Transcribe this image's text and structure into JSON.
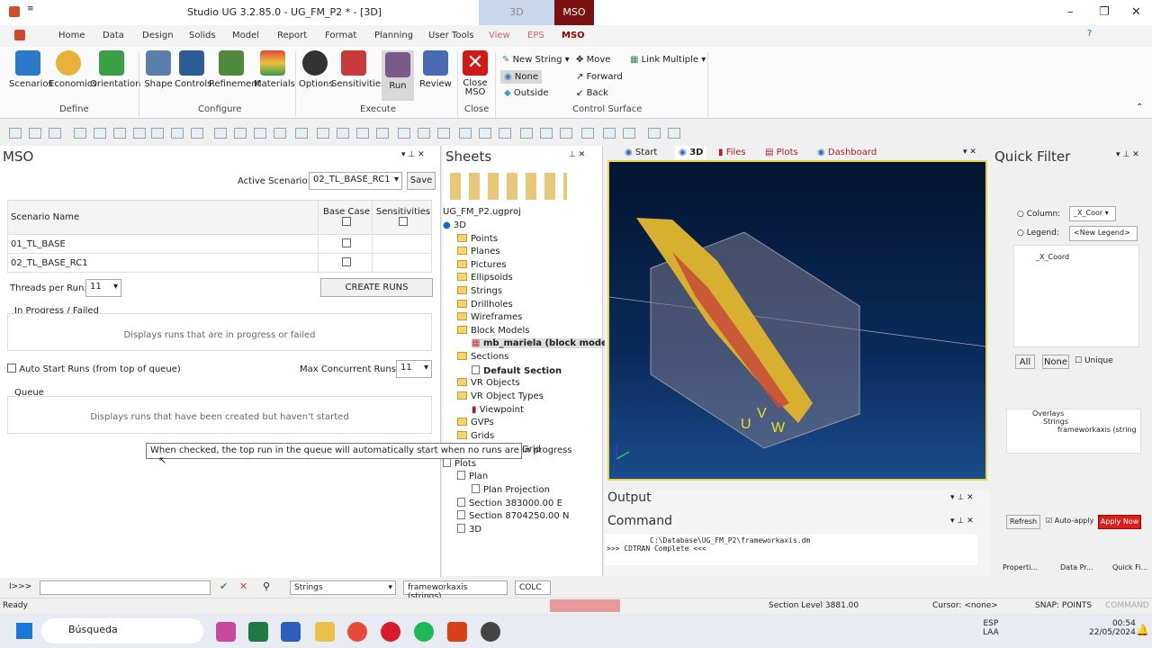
{
  "window": {
    "title": "Studio UG 3.2.85.0 - UG_FM_P2 * - [3D]",
    "ctx_tab_3d": "3D",
    "ctx_tab_mso": "MSO"
  },
  "tabs": [
    "Home",
    "Data",
    "Design",
    "Solids",
    "Model",
    "Report",
    "Format",
    "Planning",
    "User Tools",
    "View",
    "EPS",
    "MSO"
  ],
  "ribbon": {
    "define": [
      "Scenarios",
      "Economics",
      "Orientation"
    ],
    "define_label": "Define",
    "configure": [
      "Shape",
      "Controls",
      "Refinement",
      "Materials"
    ],
    "configure_label": "Configure",
    "execute": [
      "Options",
      "Sensitivities",
      "Run",
      "Review"
    ],
    "execute_label": "Execute",
    "close": "Close\nMSO",
    "close_label": "Close",
    "cs": {
      "new_string": "New String",
      "none": "None",
      "outside": "Outside",
      "move": "Move",
      "forward": "Forward",
      "back": "Back",
      "link": "Link Multiple",
      "label": "Control Surface"
    }
  },
  "mso": {
    "title": "MSO",
    "active_scenario_label": "Active Scenario:",
    "active_scenario": "02_TL_BASE_RC1",
    "save": "Save",
    "col_name": "Scenario Name",
    "col_base": "Base Case",
    "col_sens": "Sensitivities",
    "rows": [
      {
        "name": "01_TL_BASE"
      },
      {
        "name": "02_TL_BASE_RC1"
      }
    ],
    "threads_label": "Threads per Run:",
    "threads": "11",
    "create_runs": "CREATE RUNS",
    "inprogress_label": "In Progress / Failed",
    "inprogress_hint": "Displays runs that are in progress or failed",
    "autostart": "Auto Start Runs (from top of queue)",
    "max_label": "Max Concurrent Runs:",
    "max": "11",
    "queue_label": "Queue",
    "queue_hint": "Displays runs that have been created but haven't started",
    "tooltip": "When checked, the top run in the queue will automatically start when no runs are in progress"
  },
  "sheets": {
    "title": "Sheets",
    "project": "UG_FM_P2.ugproj",
    "items": [
      "3D",
      "Points",
      "Planes",
      "Pictures",
      "Ellipsoids",
      "Strings",
      "Drillholes",
      "Wireframes",
      "Block Models",
      "mb_mariela (block model)",
      "Sections",
      "Default Section",
      "VR Objects",
      "VR Object Types",
      "Viewpoint",
      "GVPs",
      "Grids",
      "Grid",
      "Plots",
      "Plan",
      "Plan Projection",
      "Section 383000.00 E",
      "Section 8704250.00 N",
      "3D"
    ]
  },
  "viewtabs": [
    "Start",
    "3D",
    "Files",
    "Plots",
    "Dashboard"
  ],
  "axis": {
    "u": "U",
    "v": "V",
    "w": "W"
  },
  "output": {
    "title": "Output",
    "cmd_title": "Command",
    "line1": "C:\\Database\\UG_FM_P2\\frameworkaxis.dm",
    "line2": ">>> CDTRAN   Complete <<<"
  },
  "qf": {
    "title": "Quick Filter",
    "column_label": "Column:",
    "column": "_X_Coor",
    "legend_label": "Legend:",
    "legend": "<New Legend>",
    "item": "_X_Coord",
    "all": "All",
    "none": "None",
    "unique": "Unique",
    "overlays": "Overlays",
    "strings": "Strings",
    "fw": "frameworkaxis (string",
    "refresh": "Refresh",
    "autoapply": "Auto-apply",
    "apply": "Apply Now"
  },
  "bottomtabs": [
    "Properti...",
    "Data Pr...",
    "Quick Fi..."
  ],
  "cmd": {
    "prompt": "I>>>",
    "strings": "Strings",
    "fw": "frameworkaxis (strings)",
    "colc": "COLC"
  },
  "status": {
    "ready": "Ready",
    "section": "Section Level 3881.00",
    "cursor": "Cursor: <none>",
    "snap": "SNAP: POINTS",
    "command": "COMMAND"
  },
  "taskbar": {
    "search": "Búsqueda",
    "lang1": "ESP",
    "lang2": "LAA",
    "time": "00:54",
    "date": "22/05/2024"
  },
  "colors": {
    "accent": "#c00000",
    "canvas": "#0a2a5a",
    "frame": "#e8d44a"
  }
}
